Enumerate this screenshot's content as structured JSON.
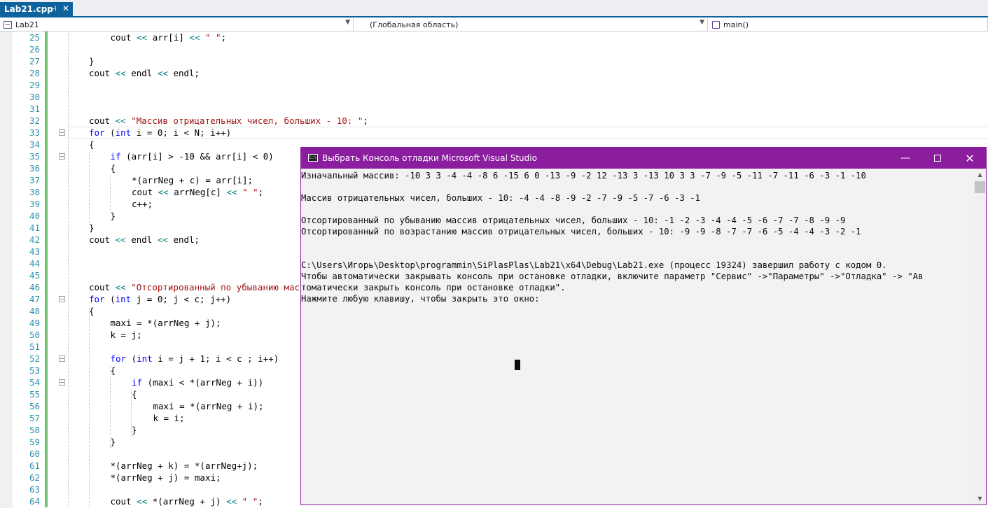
{
  "tab": {
    "filename": "Lab21.cpp",
    "pin_icon": "pin-icon",
    "close_icon": "close-icon"
  },
  "navbar": {
    "project": "Lab21",
    "scope": "(Глобальная область)",
    "function": "main()"
  },
  "code_lines": [
    {
      "num": "25",
      "indent": 1,
      "parts": [
        [
          "id",
          "cout "
        ],
        [
          "op",
          "<<"
        ],
        [
          "id",
          " arr[i] "
        ],
        [
          "op",
          "<<"
        ],
        [
          "str",
          " \" \""
        ],
        [
          "id",
          ";"
        ]
      ]
    },
    {
      "num": "26",
      "indent": 0,
      "parts": []
    },
    {
      "num": "27",
      "indent": 0,
      "parts": [
        [
          "id",
          "}"
        ]
      ]
    },
    {
      "num": "28",
      "indent": 0,
      "parts": [
        [
          "id",
          "cout "
        ],
        [
          "op",
          "<<"
        ],
        [
          "id",
          " endl "
        ],
        [
          "op",
          "<<"
        ],
        [
          "id",
          " endl;"
        ]
      ]
    },
    {
      "num": "29",
      "indent": 0,
      "parts": []
    },
    {
      "num": "30",
      "indent": 0,
      "parts": []
    },
    {
      "num": "31",
      "indent": 0,
      "parts": []
    },
    {
      "num": "32",
      "indent": 0,
      "parts": [
        [
          "id",
          "cout "
        ],
        [
          "op",
          "<<"
        ],
        [
          "str",
          " \"Массив отрицательных чисел, больших - 10: \""
        ],
        [
          "id",
          ";"
        ]
      ]
    },
    {
      "num": "33",
      "indent": 0,
      "fold": true,
      "parts": [
        [
          "kw",
          "for"
        ],
        [
          "id",
          " ("
        ],
        [
          "kw",
          "int"
        ],
        [
          "id",
          " i = 0; i < N; i++)"
        ]
      ]
    },
    {
      "num": "34",
      "indent": 0,
      "parts": [
        [
          "id",
          "{"
        ]
      ]
    },
    {
      "num": "35",
      "indent": 1,
      "fold": true,
      "parts": [
        [
          "kw",
          "if"
        ],
        [
          "id",
          " (arr[i] > -10 && arr[i] < 0)"
        ]
      ]
    },
    {
      "num": "36",
      "indent": 1,
      "parts": [
        [
          "id",
          "{"
        ]
      ]
    },
    {
      "num": "37",
      "indent": 2,
      "parts": [
        [
          "id",
          "*(arrNeg + c) = arr[i];"
        ]
      ]
    },
    {
      "num": "38",
      "indent": 2,
      "parts": [
        [
          "id",
          "cout "
        ],
        [
          "op",
          "<<"
        ],
        [
          "id",
          " arrNeg[c] "
        ],
        [
          "op",
          "<<"
        ],
        [
          "str",
          " \" \""
        ],
        [
          "id",
          ";"
        ]
      ]
    },
    {
      "num": "39",
      "indent": 2,
      "parts": [
        [
          "id",
          "c++;"
        ]
      ]
    },
    {
      "num": "40",
      "indent": 1,
      "parts": [
        [
          "id",
          "}"
        ]
      ]
    },
    {
      "num": "41",
      "indent": 0,
      "parts": [
        [
          "id",
          "}"
        ]
      ]
    },
    {
      "num": "42",
      "indent": 0,
      "parts": [
        [
          "id",
          "cout "
        ],
        [
          "op",
          "<<"
        ],
        [
          "id",
          " endl "
        ],
        [
          "op",
          "<<"
        ],
        [
          "id",
          " endl;"
        ]
      ]
    },
    {
      "num": "43",
      "indent": 0,
      "parts": []
    },
    {
      "num": "44",
      "indent": 0,
      "parts": []
    },
    {
      "num": "45",
      "indent": 0,
      "parts": []
    },
    {
      "num": "46",
      "indent": 0,
      "parts": [
        [
          "id",
          "cout "
        ],
        [
          "op",
          "<<"
        ],
        [
          "str",
          " \"Отсортированный по убыванию мас"
        ]
      ]
    },
    {
      "num": "47",
      "indent": 0,
      "fold": true,
      "parts": [
        [
          "kw",
          "for"
        ],
        [
          "id",
          " ("
        ],
        [
          "kw",
          "int"
        ],
        [
          "id",
          " j = 0; j < c; j++)"
        ]
      ]
    },
    {
      "num": "48",
      "indent": 0,
      "parts": [
        [
          "id",
          "{"
        ]
      ]
    },
    {
      "num": "49",
      "indent": 1,
      "parts": [
        [
          "id",
          "maxi = *(arrNeg + j);"
        ]
      ]
    },
    {
      "num": "50",
      "indent": 1,
      "parts": [
        [
          "id",
          "k = j;"
        ]
      ]
    },
    {
      "num": "51",
      "indent": 0,
      "parts": []
    },
    {
      "num": "52",
      "indent": 1,
      "fold": true,
      "parts": [
        [
          "kw",
          "for"
        ],
        [
          "id",
          " ("
        ],
        [
          "kw",
          "int"
        ],
        [
          "id",
          " i = j + 1; i < c ; i++)"
        ]
      ]
    },
    {
      "num": "53",
      "indent": 1,
      "parts": [
        [
          "id",
          "{"
        ]
      ]
    },
    {
      "num": "54",
      "indent": 2,
      "fold": true,
      "parts": [
        [
          "kw",
          "if"
        ],
        [
          "id",
          " (maxi < *(arrNeg + i))"
        ]
      ]
    },
    {
      "num": "55",
      "indent": 2,
      "parts": [
        [
          "id",
          "{"
        ]
      ]
    },
    {
      "num": "56",
      "indent": 3,
      "parts": [
        [
          "id",
          "maxi = *(arrNeg + i);"
        ]
      ]
    },
    {
      "num": "57",
      "indent": 3,
      "parts": [
        [
          "id",
          "k = i;"
        ]
      ]
    },
    {
      "num": "58",
      "indent": 2,
      "parts": [
        [
          "id",
          "}"
        ]
      ]
    },
    {
      "num": "59",
      "indent": 1,
      "parts": [
        [
          "id",
          "}"
        ]
      ]
    },
    {
      "num": "60",
      "indent": 0,
      "parts": []
    },
    {
      "num": "61",
      "indent": 1,
      "parts": [
        [
          "id",
          "*(arrNeg + k) = *(arrNeg+j);"
        ]
      ]
    },
    {
      "num": "62",
      "indent": 1,
      "parts": [
        [
          "id",
          "*(arrNeg + j) = maxi;"
        ]
      ]
    },
    {
      "num": "63",
      "indent": 0,
      "parts": []
    },
    {
      "num": "64",
      "indent": 1,
      "parts": [
        [
          "id",
          "cout "
        ],
        [
          "op",
          "<<"
        ],
        [
          "id",
          " *(arrNeg + j) "
        ],
        [
          "op",
          "<<"
        ],
        [
          "str",
          " \" \""
        ],
        [
          "id",
          ";"
        ]
      ]
    }
  ],
  "console": {
    "title": "Выбрать Консоль отладки Microsoft Visual Studio",
    "icon_label": "C:\\",
    "minimize_label": "—",
    "close_label": "✕",
    "lines": [
      "Изначальный массив: -10 3 3 -4 -4 -8 6 -15 6 0 -13 -9 -2 12 -13 3 -13 10 3 3 -7 -9 -5 -11 -7 -11 -6 -3 -1 -10",
      "",
      "Массив отрицательных чисел, больших - 10: -4 -4 -8 -9 -2 -7 -9 -5 -7 -6 -3 -1",
      "",
      "Отсортированный по убыванию массив отрицательных чисел, больших - 10: -1 -2 -3 -4 -4 -5 -6 -7 -7 -8 -9 -9",
      "Отсортированный по возрастанию массив отрицательных чисел, больших - 10: -9 -9 -8 -7 -7 -6 -5 -4 -4 -3 -2 -1",
      "",
      "",
      "C:\\Users\\Игорь\\Desktop\\programmin\\SiPlasPlas\\Lab21\\x64\\Debug\\Lab21.exe (процесс 19324) завершил работу с кодом 0.",
      "Чтобы автоматически закрывать консоль при остановке отладки, включите параметр \"Сервис\" ->\"Параметры\" ->\"Отладка\" -> \"Ав",
      "томатически закрыть консоль при остановке отладки\".",
      "Нажмите любую клавишу, чтобы закрыть это окно:"
    ]
  }
}
